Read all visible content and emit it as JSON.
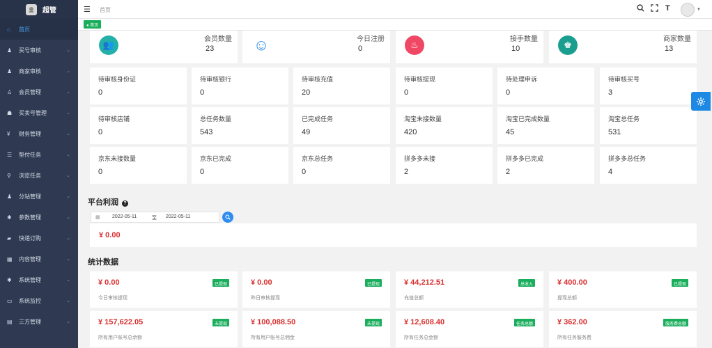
{
  "app": {
    "title": "超管"
  },
  "sidebar": {
    "items": [
      {
        "label": "首页",
        "icon": "home-icon",
        "glyph": "⌂"
      },
      {
        "label": "买号审核",
        "icon": "user-check-icon",
        "glyph": "♟"
      },
      {
        "label": "商家审核",
        "icon": "shop-user-icon",
        "glyph": "♟"
      },
      {
        "label": "会员管理",
        "icon": "member-icon",
        "glyph": "♙"
      },
      {
        "label": "买卖号管理",
        "icon": "account-icon",
        "glyph": "☗"
      },
      {
        "label": "财务管理",
        "icon": "yen-icon",
        "glyph": "¥"
      },
      {
        "label": "垫付任务",
        "icon": "list-icon",
        "glyph": "☰"
      },
      {
        "label": "浏览任务",
        "icon": "search-icon",
        "glyph": "⚲"
      },
      {
        "label": "分站管理",
        "icon": "branch-icon",
        "glyph": "♟"
      },
      {
        "label": "参数管理",
        "icon": "gear-icon",
        "glyph": "✱"
      },
      {
        "label": "快递订购",
        "icon": "truck-icon",
        "glyph": "▰"
      },
      {
        "label": "内容管理",
        "icon": "grid-icon",
        "glyph": "▦"
      },
      {
        "label": "系统管理",
        "icon": "settings-icon",
        "glyph": "✱"
      },
      {
        "label": "系统监控",
        "icon": "monitor-icon",
        "glyph": "▭"
      },
      {
        "label": "三方管理",
        "icon": "third-party-icon",
        "glyph": "▤"
      }
    ]
  },
  "header": {
    "breadcrumb": "首页",
    "tag": "首页"
  },
  "top_stats": [
    {
      "label": "会员数量",
      "value": "23",
      "icon": "users-icon",
      "color": "#23b0a8",
      "glyph": "👥"
    },
    {
      "label": "今日注册",
      "value": "0",
      "icon": "robot-icon",
      "color": "#2e8cf0",
      "glyph": "☺"
    },
    {
      "label": "接手数量",
      "value": "10",
      "icon": "fire-icon",
      "color": "#f04864",
      "glyph": "♨"
    },
    {
      "label": "商家数量",
      "value": "13",
      "icon": "merchant-icon",
      "color": "#1a9e8f",
      "glyph": "♚"
    }
  ],
  "metrics": [
    [
      {
        "label": "待审核身份证",
        "value": "0"
      },
      {
        "label": "待审核银行",
        "value": "0"
      },
      {
        "label": "待审核充值",
        "value": "20"
      },
      {
        "label": "待审核提现",
        "value": "0"
      },
      {
        "label": "待处理申诉",
        "value": "0"
      },
      {
        "label": "待审核买号",
        "value": "3"
      }
    ],
    [
      {
        "label": "待审核店铺",
        "value": "0"
      },
      {
        "label": "总任务数量",
        "value": "543"
      },
      {
        "label": "已完成任务",
        "value": "49"
      },
      {
        "label": "淘宝未接数量",
        "value": "420"
      },
      {
        "label": "淘宝已完成数量",
        "value": "45"
      },
      {
        "label": "淘宝总任务",
        "value": "531"
      }
    ],
    [
      {
        "label": "京东未接数量",
        "value": "0"
      },
      {
        "label": "京东已完成",
        "value": "0"
      },
      {
        "label": "京东总任务",
        "value": "0"
      },
      {
        "label": "拼多多未接",
        "value": "2"
      },
      {
        "label": "拼多多已完成",
        "value": "2"
      },
      {
        "label": "拼多多总任务",
        "value": "4"
      }
    ]
  ],
  "profit": {
    "title": "平台利润",
    "date_start": "2022-05-11",
    "separator": "至",
    "date_end": "2022-05-11",
    "amount": "¥ 0.00"
  },
  "stats": {
    "title": "统计数据",
    "rows": [
      [
        {
          "amount": "¥ 0.00",
          "label": "今日审核提现",
          "badge": "已提现"
        },
        {
          "amount": "¥ 0.00",
          "label": "昨日审核提现",
          "badge": "已提现"
        },
        {
          "amount": "¥ 44,212.51",
          "label": "充值总额",
          "badge": "总收入"
        },
        {
          "amount": "¥ 400.00",
          "label": "提现总额",
          "badge": "已提现"
        }
      ],
      [
        {
          "amount": "¥ 157,622.05",
          "label": "所有用户账号总余额",
          "badge": "未提现"
        },
        {
          "amount": "¥ 100,088.50",
          "label": "所有用户账号总佣金",
          "badge": "未提现"
        },
        {
          "amount": "¥ 12,608.40",
          "label": "所有任务总金额",
          "badge": "任务总额"
        },
        {
          "amount": "¥ 362.00",
          "label": "所有任务服务费",
          "badge": "服务费总额"
        }
      ]
    ]
  }
}
